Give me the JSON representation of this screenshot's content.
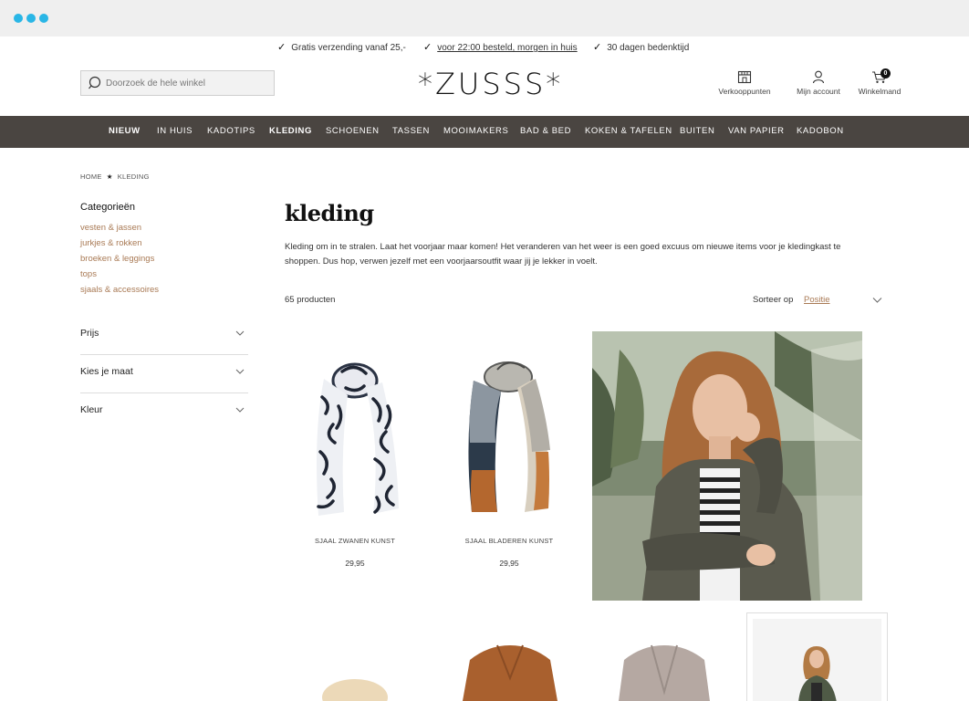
{
  "usp": [
    {
      "text": "Gratis verzending vanaf 25,-",
      "underline": false
    },
    {
      "text": "voor 22:00 besteld, morgen in huis",
      "underline": true
    },
    {
      "text": "30 dagen bedenktijd",
      "underline": false
    }
  ],
  "search": {
    "placeholder": "Doorzoek de hele winkel"
  },
  "logo": "*ZUSSS*",
  "header_icons": {
    "stores": "Verkooppunten",
    "account": "Mijn account",
    "cart": "Winkelmand",
    "cart_count": "0"
  },
  "nav": [
    "NIEUW",
    "IN HUIS",
    "KADOTIPS",
    "KLEDING",
    "SCHOENEN",
    "TASSEN",
    "MOOIMAKERS",
    "BAD & BED",
    "KOKEN & TAFELEN",
    "BUITEN",
    "VAN PAPIER",
    "KADOBON"
  ],
  "breadcrumb": {
    "home": "HOME",
    "separator": "★",
    "current": "KLEDING"
  },
  "sidebar": {
    "title": "Categorieën",
    "categories": [
      "vesten & jassen",
      "jurkjes & rokken",
      "broeken & leggings",
      "tops",
      "sjaals & accessoires"
    ],
    "filters": [
      "Prijs",
      "Kies je maat",
      "Kleur"
    ]
  },
  "main": {
    "title": "kleding",
    "description": "Kleding om in te stralen. Laat het voorjaar maar komen! Het veranderen van het weer is een goed excuus om nieuwe items voor je kledingkast te shoppen. Dus hop, verwen jezelf met een voorjaarsoutfit waar jij je lekker in voelt.",
    "count": "65 producten",
    "sort_label": "Sorteer op",
    "sort_value": "Positie"
  },
  "products": [
    {
      "name": "SJAAL ZWANEN KUNST",
      "price": "29,95"
    },
    {
      "name": "SJAAL BLADEREN KUNST",
      "price": "29,95"
    }
  ],
  "colors": {
    "nav_bg": "#4a4541",
    "accent_link": "#a97a55",
    "chrome_dots": "#29b6e6"
  }
}
